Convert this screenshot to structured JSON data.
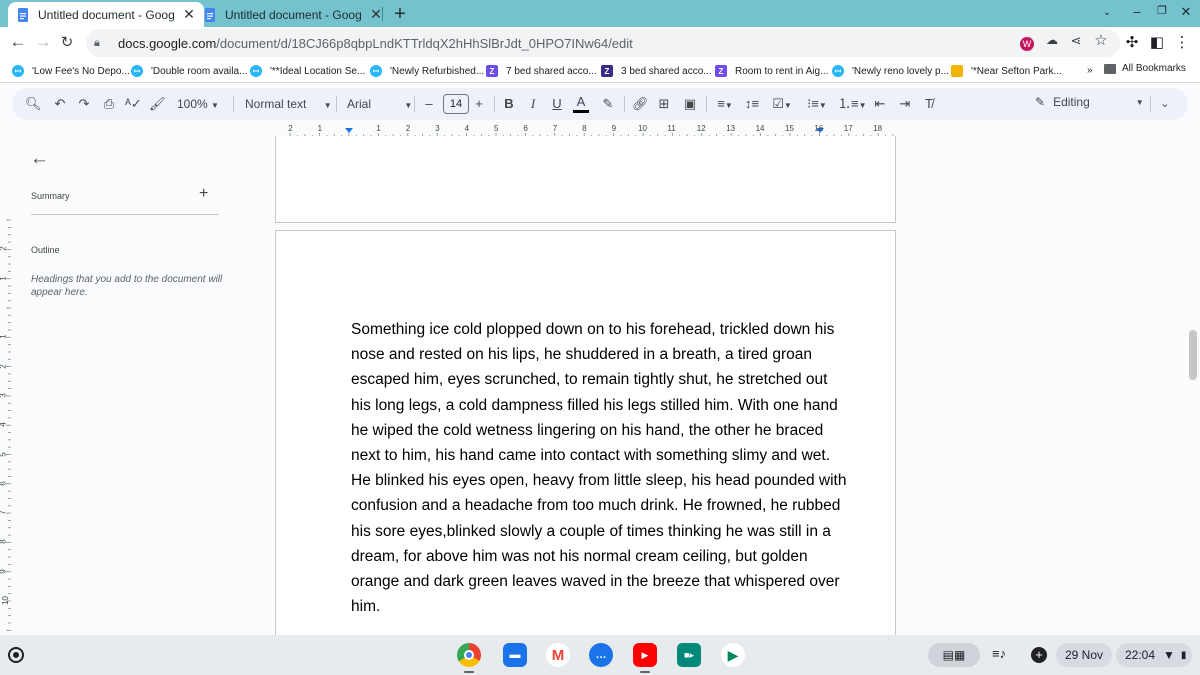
{
  "browser": {
    "tabs": [
      {
        "title": "Untitled document - Google Docs",
        "active": true
      },
      {
        "title": "Untitled document - Google Docs",
        "active": false
      }
    ],
    "new_tab_label": "+",
    "url_host": "docs.google.com",
    "url_path": "/document/d/18CJ66p8qbpLndKTTrldqX2hHhSlBrJdt_0HPO7INw64/edit",
    "extension_badge": "W"
  },
  "bookmarks": {
    "items": [
      {
        "label": "'Low Fee's No Depo...",
        "icon": "circle-logo"
      },
      {
        "label": "'Double room availa...",
        "icon": "circle-logo"
      },
      {
        "label": "'**Ideal Location Se...",
        "icon": "circle-logo"
      },
      {
        "label": "'Newly Refurbished...",
        "icon": "circle-logo"
      },
      {
        "label": "7 bed shared acco...",
        "icon": "z-logo"
      },
      {
        "label": "3 bed shared acco...",
        "icon": "z-dark-logo"
      },
      {
        "label": "Room to rent in Aig...",
        "icon": "z-logo"
      },
      {
        "label": "'Newly reno lovely p...",
        "icon": "circle-logo"
      },
      {
        "label": "'*Near Sefton Park...",
        "icon": "photo-logo"
      }
    ],
    "more": "»",
    "all_bookmarks": "All Bookmarks"
  },
  "toolbar": {
    "zoom": "100%",
    "style": "Normal text",
    "font": "Arial",
    "font_size": "14",
    "bold": "B",
    "italic": "I",
    "underline": "U",
    "text_color": "A",
    "mode": "Editing"
  },
  "ruler": {
    "horizontal": [
      "2",
      "1",
      "1",
      "2",
      "3",
      "4",
      "5",
      "6",
      "7",
      "8",
      "9",
      "10",
      "11",
      "12",
      "13",
      "14",
      "15",
      "16",
      "17",
      "18"
    ],
    "vertical": [
      "2",
      "1",
      "1",
      "2",
      "3",
      "4",
      "5",
      "6",
      "7",
      "8",
      "9",
      "10",
      "11"
    ]
  },
  "side_panel": {
    "summary": "Summary",
    "outline": "Outline",
    "outline_empty": "Headings that you add to the document will appear here."
  },
  "document": {
    "lines": [
      "Something ice cold plopped down on to his forehead, trickled down his",
      "nose and rested on his lips, he shuddered in a breath, a tired groan",
      "escaped him, eyes scrunched, to remain tightly shut, he stretched out",
      "his long legs, a cold dampness filled his legs stilled him. With one hand",
      "he wiped the cold wetness lingering on his hand, the other he braced",
      "next to him, his hand came into contact with something slimy and wet.",
      "He blinked his eyes open, heavy from little sleep, his head pounded with",
      "confusion and a headache from too much drink. He frowned,  he rubbed",
      "his sore eyes,blinked slowly a couple of times thinking he was still in a",
      "dream, for above him was not his normal cream ceiling, but golden",
      "orange and dark green leaves waved in the breeze that whispered over",
      "him."
    ]
  },
  "shelf": {
    "apps": [
      "chrome",
      "files",
      "gmail",
      "messages",
      "youtube",
      "meet",
      "play-store"
    ],
    "date": "29 Nov",
    "time": "22:04"
  },
  "colors": {
    "tabstrip": "#75c2cf",
    "toolbar_bg": "#edf2fa",
    "canvas_bg": "#f9fbfd",
    "ruler_marker": "#1a73e8"
  }
}
